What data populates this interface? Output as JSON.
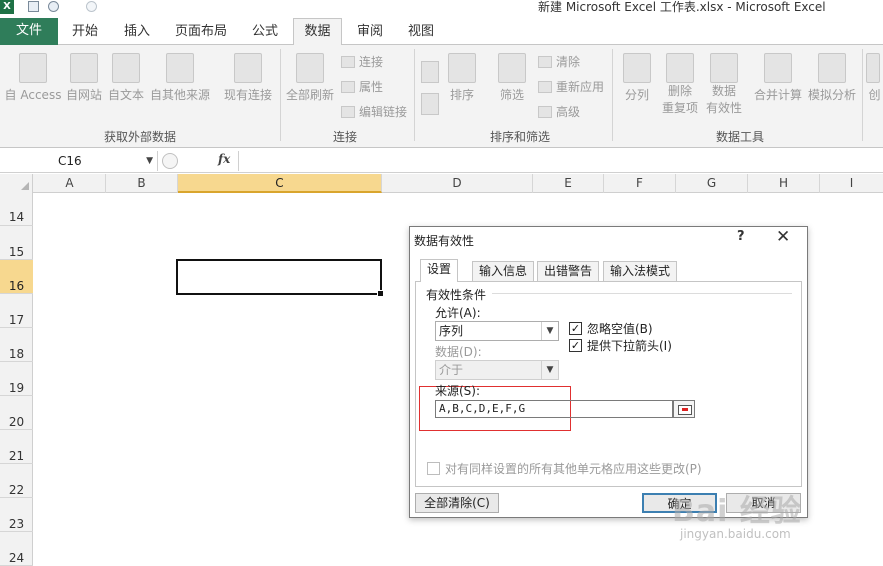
{
  "window": {
    "title": "新建 Microsoft Excel 工作表.xlsx  -  Microsoft Excel"
  },
  "tabs": [
    {
      "label": "文件"
    },
    {
      "label": "开始"
    },
    {
      "label": "插入"
    },
    {
      "label": "页面布局"
    },
    {
      "label": "公式"
    },
    {
      "label": "数据"
    },
    {
      "label": "审阅"
    },
    {
      "label": "视图"
    }
  ],
  "ribbon": {
    "ext": {
      "access": "自 Access",
      "web": "自网站",
      "text": "自文本",
      "other": "自其他来源",
      "existing": "现有连接",
      "group": "获取外部数据"
    },
    "conn": {
      "refresh": "全部刷新",
      "connections": "连接",
      "properties": "属性",
      "edit_links": "编辑链接",
      "group": "连接"
    },
    "sort": {
      "sort": "排序",
      "filter": "筛选",
      "clear": "清除",
      "reapply": "重新应用",
      "advanced": "高级",
      "group": "排序和筛选"
    },
    "tools": {
      "split": "分列",
      "remove_dup_1": "删除",
      "remove_dup_2": "重复项",
      "validation_1": "数据",
      "validation_2": "有效性",
      "consolidate": "合并计算",
      "whatif": "模拟分析",
      "outline": "创",
      "group": "数据工具"
    }
  },
  "formula_bar": {
    "name_box": "C16",
    "fx": "fx",
    "value": ""
  },
  "columns": [
    "A",
    "B",
    "C",
    "D",
    "E",
    "F",
    "G",
    "H",
    "I"
  ],
  "rows": [
    "14",
    "15",
    "16",
    "17",
    "18",
    "19",
    "20",
    "21",
    "22",
    "23",
    "24"
  ],
  "selected": {
    "column": "C",
    "row": "16"
  },
  "dialog": {
    "title": "数据有效性",
    "help": "?",
    "close": "✕",
    "tabs": [
      "设置",
      "输入信息",
      "出错警告",
      "输入法模式"
    ],
    "section": "有效性条件",
    "allow_label": "允许(A):",
    "allow_value": "序列",
    "data_label": "数据(D):",
    "data_value": "介于",
    "ignore_blank": "忽略空值(B)",
    "dropdown_arrow": "提供下拉箭头(I)",
    "source_label": "来源(S):",
    "source_value": "A,B,C,D,E,F,G",
    "apply_all": "对有同样设置的所有其他单元格应用这些更改(P)",
    "clear_all": "全部清除(C)",
    "ok": "确定",
    "cancel": "取消"
  },
  "watermark": {
    "main": "Bai 经验",
    "sub": "jingyan.baidu.com"
  }
}
